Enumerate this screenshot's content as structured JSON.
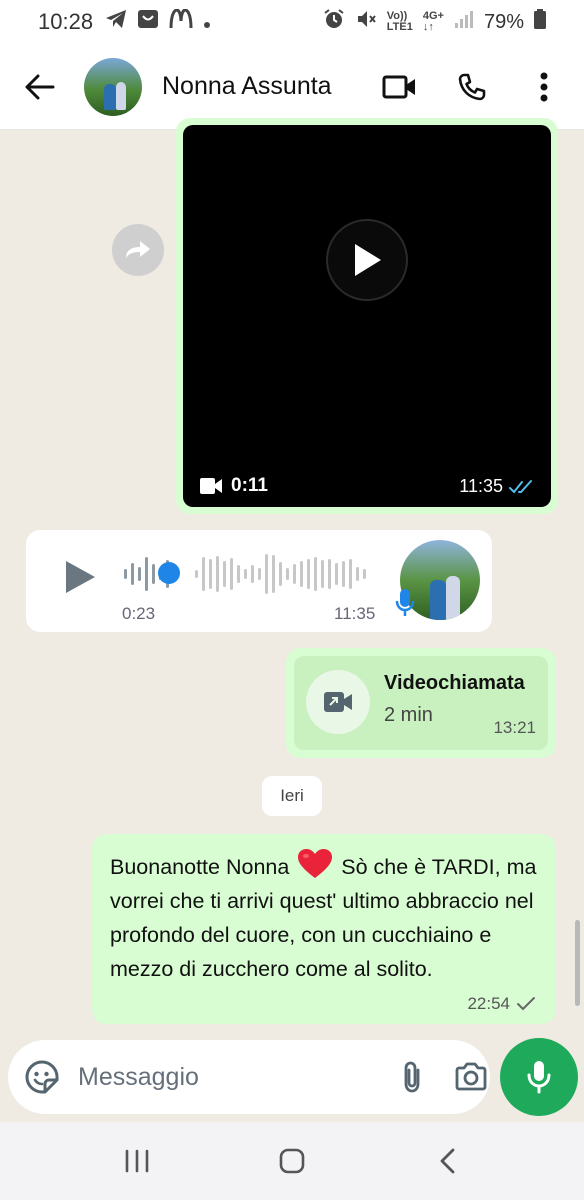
{
  "status_bar": {
    "time": "10:28",
    "network_top": "Vo))",
    "network_bottom": "LTE1",
    "data_top": "4G+",
    "data_bottom": "↓↑",
    "battery": "79%"
  },
  "header": {
    "contact_name": "Nonna Assunta"
  },
  "video_message": {
    "duration": "0:11",
    "time": "11:35",
    "status": "read"
  },
  "audio_message": {
    "duration": "0:23",
    "time": "11:35",
    "progress": 0.22
  },
  "video_call": {
    "title": "Videochiamata",
    "duration": "2 min",
    "time": "13:21"
  },
  "date_separator": "Ieri",
  "text_message": {
    "text_before": "Buonanotte Nonna",
    "text_after": "Sò che è TARDI, ma vorrei che ti arrivi quest' ultimo abbraccio nel profondo del cuore, con un cucchiaino e mezzo di zucchero come al solito.",
    "time": "22:54",
    "status": "sent"
  },
  "composer": {
    "placeholder": "Messaggio"
  },
  "colors": {
    "outgoing_bubble": "#d9fdd3",
    "incoming_bubble": "#ffffff",
    "chat_background": "#efeae2",
    "accent_green": "#1faa5b",
    "read_ticks": "#53bdeb"
  }
}
